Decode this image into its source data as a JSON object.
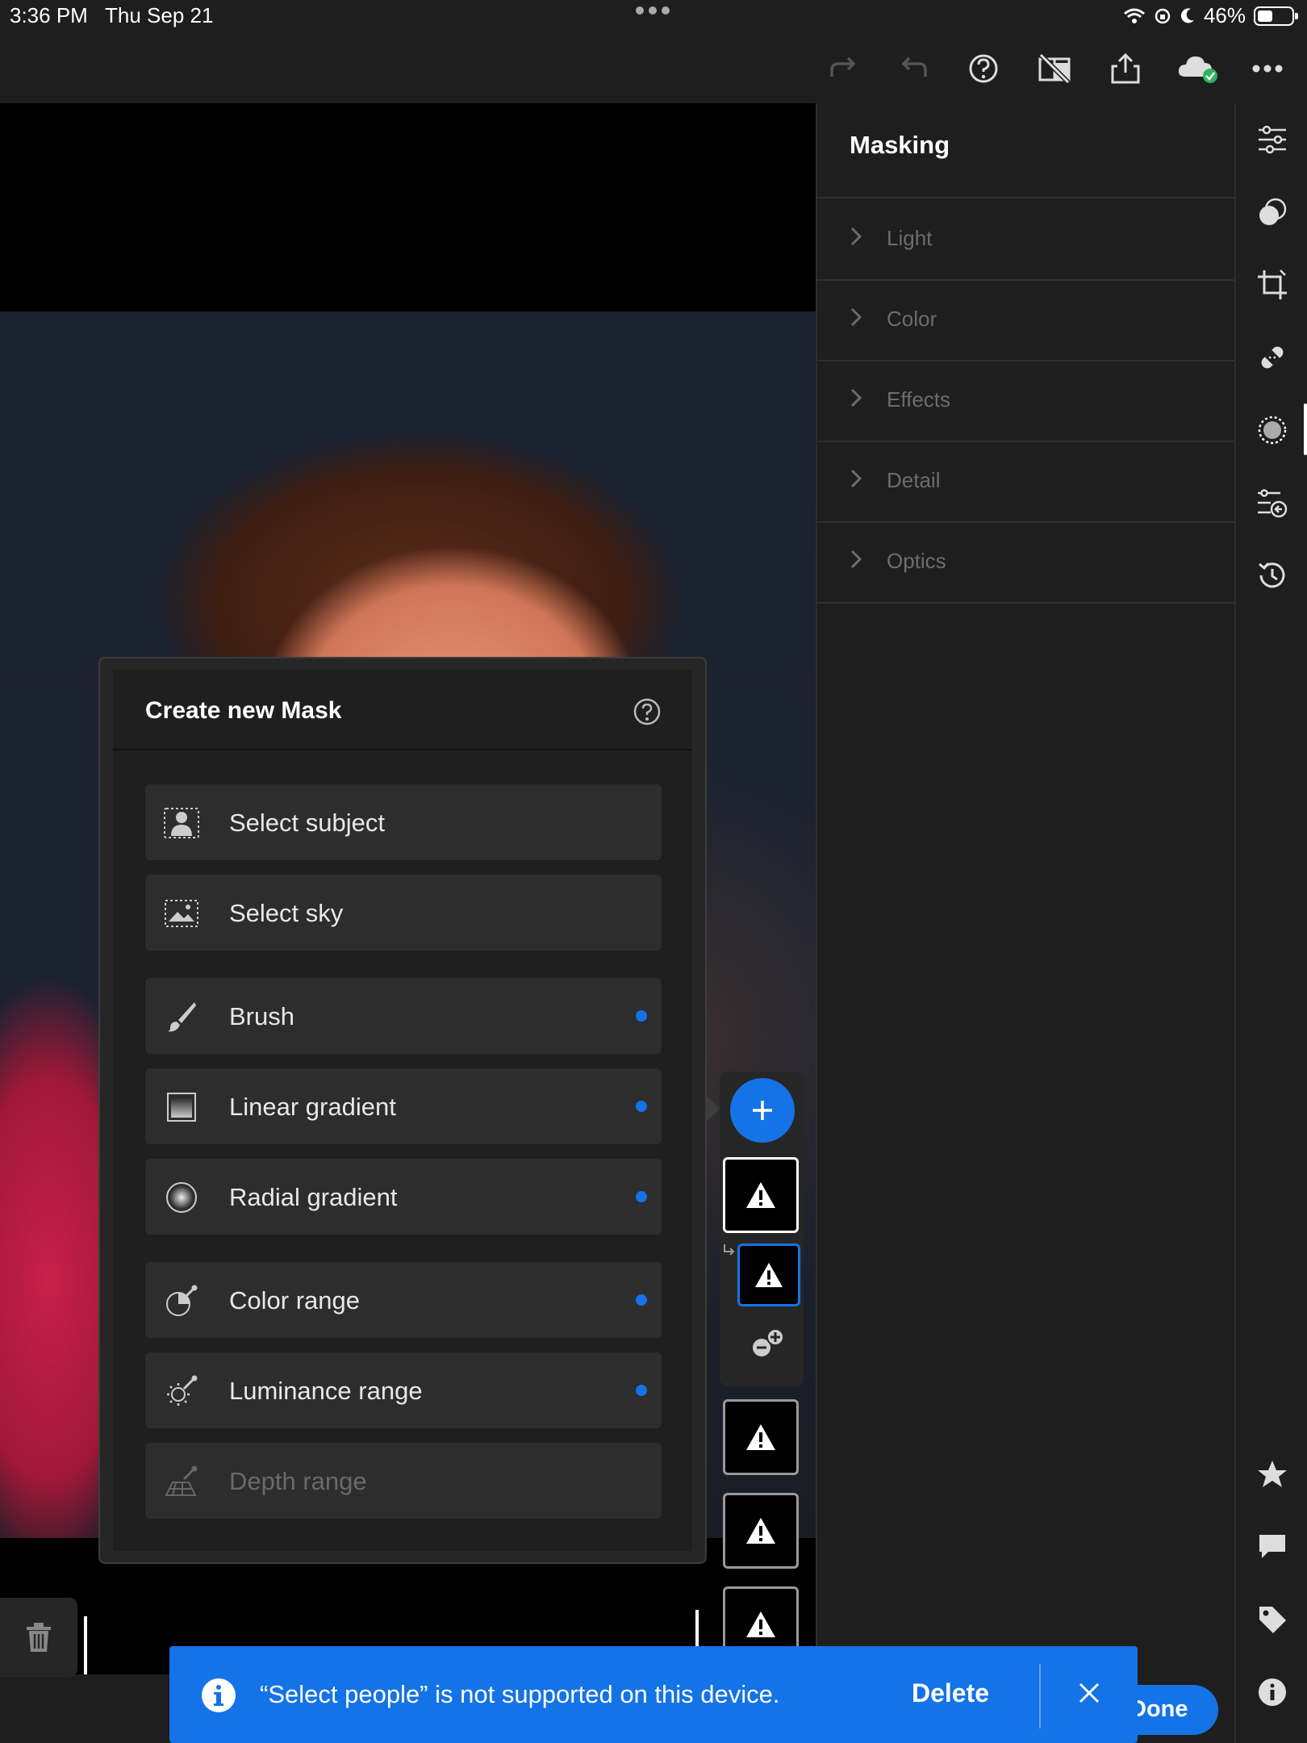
{
  "status_bar": {
    "time": "3:36 PM",
    "date": "Thu Sep 21",
    "battery": "46%",
    "battery_level": 0.46
  },
  "toolbar": {
    "icons": [
      "redo-icon",
      "undo-icon",
      "help-icon",
      "compare-off-icon",
      "share-icon",
      "cloud-synced-icon",
      "more-icon"
    ]
  },
  "panel": {
    "title": "Masking",
    "sections": [
      {
        "label": "Light"
      },
      {
        "label": "Color"
      },
      {
        "label": "Effects"
      },
      {
        "label": "Detail"
      },
      {
        "label": "Optics"
      }
    ]
  },
  "rail": {
    "icons": [
      "edit-sliders-icon",
      "presets-icon",
      "crop-icon",
      "healing-icon",
      "masking-icon",
      "versions-icon",
      "history-icon",
      "rating-icon",
      "comment-icon",
      "tag-icon",
      "info-icon"
    ],
    "active": "masking-icon"
  },
  "mask_popup": {
    "title": "Create new Mask",
    "options": [
      {
        "label": "Select subject",
        "icon": "select-subject-icon",
        "new": false,
        "enabled": true
      },
      {
        "label": "Select sky",
        "icon": "select-sky-icon",
        "new": false,
        "enabled": true
      },
      {
        "label": "Brush",
        "icon": "brush-icon",
        "new": true,
        "enabled": true
      },
      {
        "label": "Linear gradient",
        "icon": "linear-gradient-icon",
        "new": true,
        "enabled": true
      },
      {
        "label": "Radial gradient",
        "icon": "radial-gradient-icon",
        "new": true,
        "enabled": true
      },
      {
        "label": "Color range",
        "icon": "color-range-icon",
        "new": true,
        "enabled": true
      },
      {
        "label": "Luminance range",
        "icon": "luminance-range-icon",
        "new": true,
        "enabled": true
      },
      {
        "label": "Depth range",
        "icon": "depth-range-icon",
        "new": false,
        "enabled": false
      }
    ]
  },
  "toast": {
    "message": "“Select people” is not supported on this device.",
    "action": "Delete"
  },
  "done_button": {
    "label": "Done"
  },
  "colors": {
    "accent": "#1473e6",
    "background": "#1e1e1e",
    "panel": "#262626"
  }
}
